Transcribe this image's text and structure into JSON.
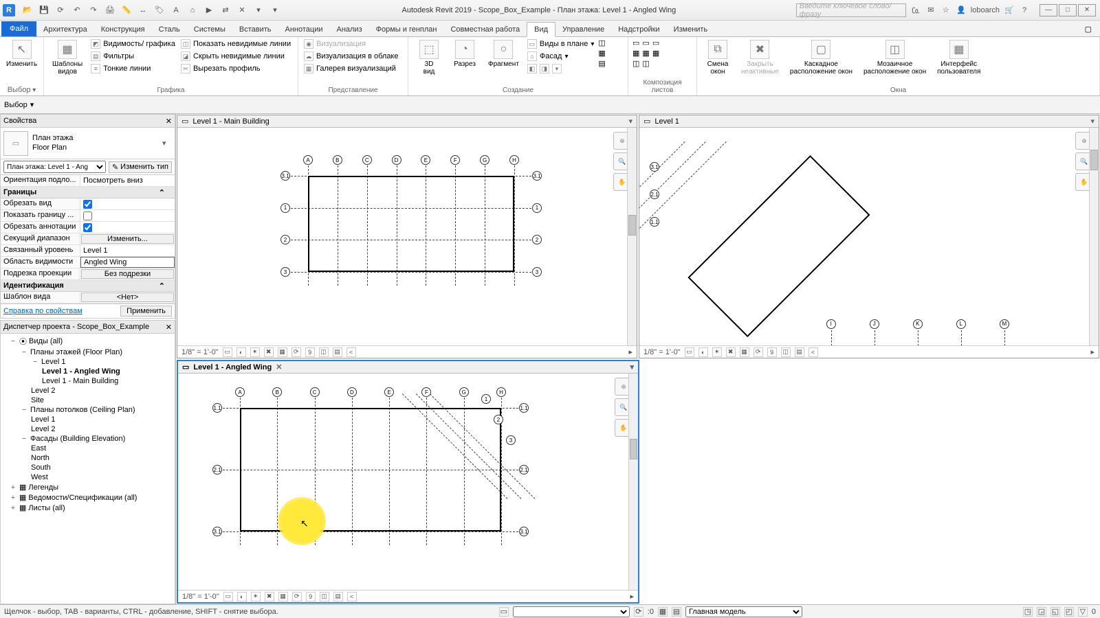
{
  "app": {
    "title": "Autodesk Revit 2019 - Scope_Box_Example - План этажа: Level 1 - Angled Wing",
    "icon_letter": "R"
  },
  "search": {
    "placeholder": "Введите ключевое слово/фразу"
  },
  "user": {
    "name": "loboarch"
  },
  "tabs": {
    "file": "Файл",
    "items": [
      "Архитектура",
      "Конструкция",
      "Сталь",
      "Системы",
      "Вставить",
      "Аннотации",
      "Анализ",
      "Формы и генплан",
      "Совместная работа",
      "Вид",
      "Управление",
      "Надстройки",
      "Изменить"
    ],
    "active": "Вид"
  },
  "ribbon": {
    "select": {
      "modify": "Изменить",
      "title": "Выбор"
    },
    "templates": {
      "label": "Шаблоны\nвидов"
    },
    "graphics": {
      "vis": "Видимость/ графика",
      "filters": "Фильтры",
      "thin": "Тонкие линии",
      "show_hidden": "Показать невидимые линии",
      "remove_hidden": "Скрыть невидимые линии",
      "cut_profile": "Вырезать профиль",
      "title": "Графика"
    },
    "present": {
      "render": "Визуализация",
      "cloud": "Визуализация в облаке",
      "gallery": "Галерея визуализаций",
      "title": "Представление"
    },
    "create": {
      "3d": "3D\nвид",
      "section": "Разрез",
      "callout": "Фрагмент",
      "plan": "Виды в плане",
      "elev": "Фасад",
      "title": "Создание"
    },
    "sheets": {
      "title": "Композиция листов"
    },
    "windows": {
      "switch": "Смена\nокон",
      "close": "Закрыть\nнеактивные",
      "cascade": "Каскадное\nрасположение окон",
      "tile": "Мозаичное\nрасположение окон",
      "ui": "Интерфейс\nпользователя",
      "title": "Окна"
    }
  },
  "opt": {
    "select_label": "Выбор"
  },
  "props": {
    "title": "Свойства",
    "type_cat": "План этажа",
    "type_name": "Floor Plan",
    "instance": "План этажа: Level 1 - Ang",
    "edit_type": "Изменить тип",
    "rows": [
      {
        "k": "Ориентация подло...",
        "v": "Посмотреть вниз"
      }
    ],
    "group_bounds": "Границы",
    "rows_bounds": [
      {
        "k": "Обрезать вид",
        "chk": true
      },
      {
        "k": "Показать границу ...",
        "chk": false
      },
      {
        "k": "Обрезать аннотации",
        "chk": true
      },
      {
        "k": "Секущий диапазон",
        "btn": "Изменить..."
      },
      {
        "k": "Связанный уровень",
        "v": "Level 1"
      },
      {
        "k": "Область видимости",
        "v": "Angled Wing",
        "sel": true
      },
      {
        "k": "Подрезка проекции",
        "btn": "Без подрезки"
      }
    ],
    "group_id": "Идентификация",
    "rows_id": [
      {
        "k": "Шаблон вида",
        "btn": "<Нет>"
      }
    ],
    "help": "Справка по свойствам",
    "apply": "Применить"
  },
  "browser": {
    "title": "Диспетчер проекта - Scope_Box_Example",
    "root": "Виды (all)",
    "floor_plans": "Планы этажей (Floor Plan)",
    "fp_items": [
      "Level 1",
      "Level 1 - Angled Wing",
      "Level 1 - Main Building",
      "Level 2",
      "Site"
    ],
    "fp_bold": "Level 1 - Angled Wing",
    "ceiling": "Планы потолков (Ceiling Plan)",
    "cp_items": [
      "Level 1",
      "Level 2"
    ],
    "elev": "Фасады (Building Elevation)",
    "el_items": [
      "East",
      "North",
      "South",
      "West"
    ],
    "legends": "Легенды",
    "schedules": "Ведомости/Спецификации (all)",
    "sheets": "Листы (all)"
  },
  "views": {
    "v1": {
      "title": "Level 1 - Main Building",
      "scale": "1/8\" = 1'-0\""
    },
    "v2": {
      "title": "Level 1 - Angled Wing",
      "scale": "1/8\" = 1'-0\""
    },
    "v3": {
      "title": "Level 1",
      "scale": "1/8\" = 1'-0\""
    }
  },
  "grids": {
    "letters": [
      "A",
      "B",
      "C",
      "D",
      "E",
      "F",
      "G",
      "H"
    ],
    "nums": [
      "1",
      "2",
      "3"
    ],
    "diag_letters": [
      "I",
      "J",
      "K",
      "L",
      "M"
    ],
    "diag_nums": [
      "3.1",
      "2.1",
      "1.1"
    ]
  },
  "status": {
    "hint": "Щелчок - выбор, TAB - варианты, CTRL - добавление, SHIFT - снятие выбора.",
    "zero": ":0",
    "main_model": "Главная модель"
  }
}
